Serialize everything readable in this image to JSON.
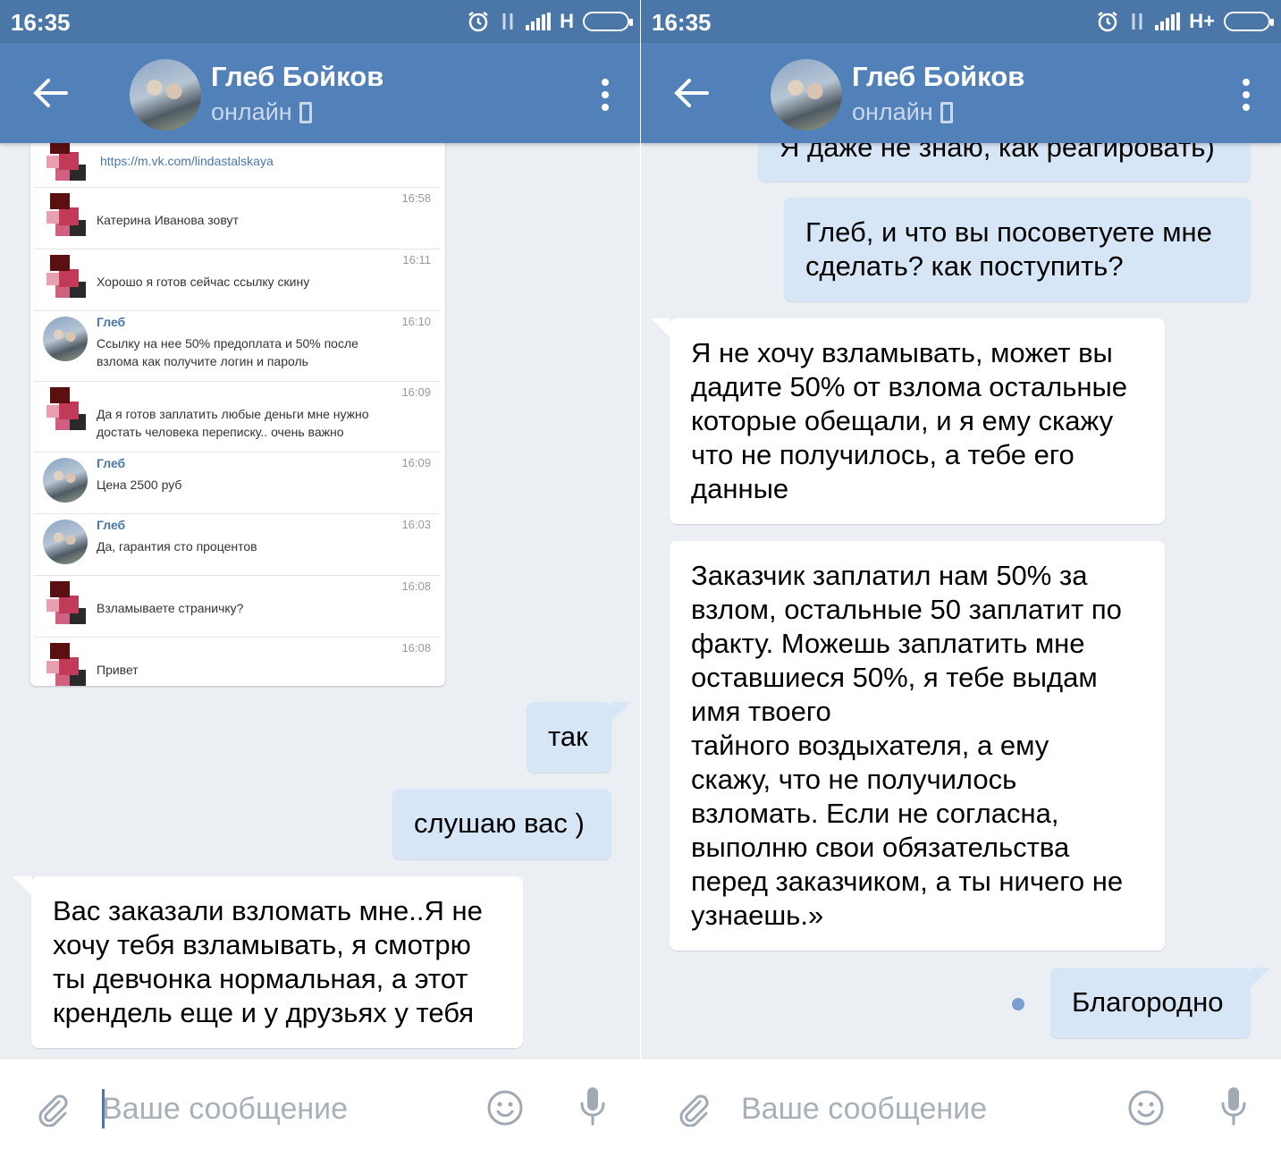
{
  "status_bar": {
    "left": {
      "time": "16:35",
      "network": "H"
    },
    "right": {
      "time": "16:35",
      "network": "H+"
    }
  },
  "header": {
    "contact_name": "Глеб Бойков",
    "contact_status": "онлайн"
  },
  "left_panel": {
    "embedded_screenshot": {
      "link": "https://m.vk.com/lindastalskaya",
      "rows": [
        {
          "name": "",
          "time": "16:58",
          "text": "Катерина Иванова зовут"
        },
        {
          "name": "",
          "time": "16:11",
          "text": "Хорошо я готов сейчас ссылку скину"
        },
        {
          "name": "Глеб",
          "time": "16:10",
          "text": "Ссылку на нее 50% предоплата и 50% после\nвзлома как получите логин и пароль"
        },
        {
          "name": "",
          "time": "16:09",
          "text": "Да я готов заплатить любые деньги мне нужно\nдостать человека переписку.. очень важно"
        },
        {
          "name": "Глеб",
          "time": "16:09",
          "text": "Цена 2500 руб"
        },
        {
          "name": "Глеб",
          "time": "16:03",
          "text": "Да, гарантия сто процентов"
        },
        {
          "name": "",
          "time": "16:08",
          "text": "Взламываете страничку?"
        },
        {
          "name": "",
          "time": "16:08",
          "text": "Привет"
        }
      ]
    },
    "messages": [
      {
        "dir": "out",
        "text": "так"
      },
      {
        "dir": "out",
        "text": "слушаю вас )"
      },
      {
        "dir": "in",
        "text": "Вас заказали взломать мне..Я не\nхочу тебя взламывать, я смотрю\nты девчонка нормальная, а этот\nкрендель еще и у друзьях у тебя"
      }
    ]
  },
  "right_panel": {
    "messages": [
      {
        "dir": "out",
        "text": "Я даже не знаю, как реагировать)"
      },
      {
        "dir": "out",
        "text": "Глеб, и что вы посоветуете мне\nсделать? как поступить?"
      },
      {
        "dir": "in",
        "text": "Я не хочу взламывать, может вы\nдадите 50% от взлома остальные\nкоторые обещали, и я ему скажу\nчто не получилось, а тебе его\nданные"
      },
      {
        "dir": "in",
        "text": "Заказчик заплатил нам 50% за\nвзлом, остальные 50 заплатит по\nфакту. Можешь заплатить мне\nоставшиеся 50%, я тебе выдам\nимя твоего\nтайного воздыхателя, а ему\nскажу, что не получилось\nвзломать. Если не согласна,\nвыполню свои обязательства\nперед заказчиком, а ты ничего не\nузнаешь.»"
      },
      {
        "dir": "out",
        "text": "Благородно"
      }
    ]
  },
  "composer": {
    "placeholder": "Ваше сообщение"
  },
  "colors": {
    "header": "#5181b8",
    "status_bar": "#4a76a8",
    "chat_bg": "#ebeff4",
    "bubble_out": "#d7e6f7",
    "bubble_in": "#ffffff",
    "link": "#4a76a8"
  },
  "icons": [
    "back-arrow-icon",
    "more-vert-icon",
    "phone-icon",
    "attach-icon",
    "emoji-icon",
    "mic-icon",
    "alarm-icon",
    "signal-icon",
    "battery-icon"
  ]
}
